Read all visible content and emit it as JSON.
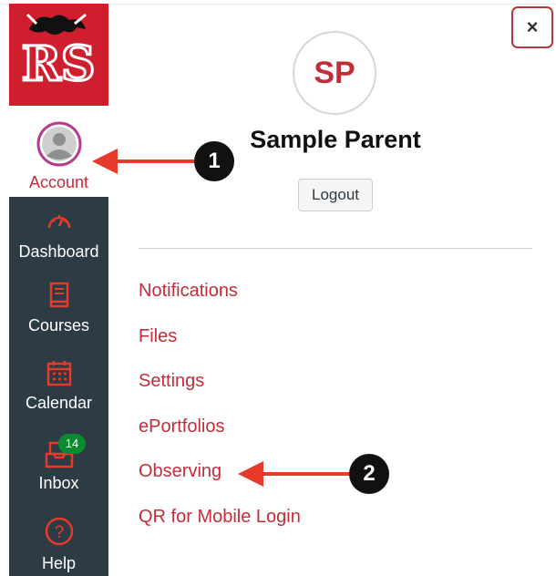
{
  "nav": {
    "logo_text": "RS",
    "account_label": "Account",
    "dashboard_label": "Dashboard",
    "courses_label": "Courses",
    "calendar_label": "Calendar",
    "inbox_label": "Inbox",
    "inbox_badge": "14",
    "help_label": "Help"
  },
  "tray": {
    "close_label": "×",
    "avatar_initials": "SP",
    "user_name": "Sample Parent",
    "logout_label": "Logout",
    "links": [
      "Notifications",
      "Files",
      "Settings",
      "ePortfolios",
      "Observing",
      "QR for Mobile Login"
    ]
  },
  "callouts": {
    "step1": "1",
    "step2": "2"
  },
  "colors": {
    "nav_bg": "#2d3b45",
    "brand_red": "#c22d3a",
    "logo_bg": "#cf1f2f",
    "badge_green": "#0b8a2f",
    "arrow_red": "#e63a2a"
  }
}
